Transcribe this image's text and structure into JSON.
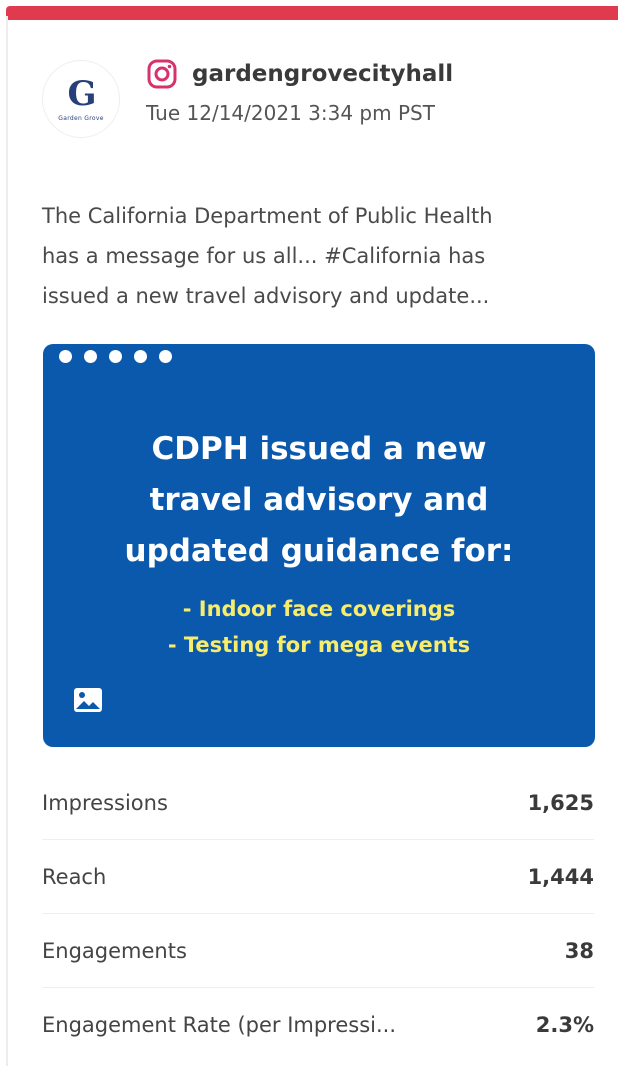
{
  "account": {
    "avatar_logo": "G",
    "avatar_caption": "Garden Grove",
    "platform_icon": "instagram-icon",
    "handle": "gardengrovecityhall",
    "timestamp": "Tue 12/14/2021 3:34 pm PST"
  },
  "post": {
    "caption_lines": [
      "The California Department of Public Health",
      "has a message for us all... #California has",
      "issued a new travel advisory and update..."
    ],
    "image": {
      "title_lines": [
        "CDPH issued a new",
        "travel advisory and",
        "updated guidance for:"
      ],
      "bullet_lines": [
        "- Indoor face coverings",
        "- Testing for mega events"
      ],
      "media_icon": "photo-icon",
      "carousel_dots": 5
    }
  },
  "metrics": [
    {
      "label": "Impressions",
      "value": "1,625"
    },
    {
      "label": "Reach",
      "value": "1,444"
    },
    {
      "label": "Engagements",
      "value": "38"
    },
    {
      "label": "Engagement Rate (per Impressi...",
      "value": "2.3%"
    }
  ],
  "colors": {
    "accent_bar": "#e03a4e",
    "image_background": "#0b59ac",
    "image_highlight_text": "#f7ec6b",
    "instagram_icon": "#d6336c"
  }
}
